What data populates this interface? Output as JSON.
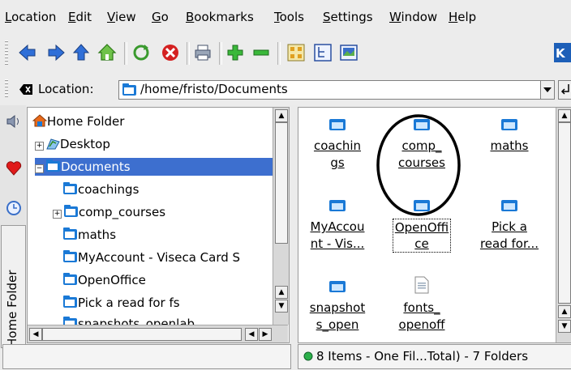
{
  "menubar": {
    "items": [
      "Location",
      "Edit",
      "View",
      "Go",
      "Bookmarks",
      "Tools",
      "Settings",
      "Window",
      "Help"
    ]
  },
  "toolbar": {
    "buttons": [
      "back-icon",
      "forward-icon",
      "up-icon",
      "home-icon",
      "reload-icon",
      "stop-icon",
      "print-icon",
      "zoom-in-icon",
      "zoom-out-icon",
      "icon-view-icon",
      "tree-view-icon",
      "image-view-icon"
    ]
  },
  "location": {
    "label": "Location:",
    "value": "/home/fristo/Documents"
  },
  "sidebar": {
    "tab_label": "Home Folder"
  },
  "tree": {
    "items": [
      {
        "label": "Home Folder",
        "icon": "home-folder-icon",
        "level": 0
      },
      {
        "label": "Desktop",
        "icon": "desktop-icon",
        "level": 1,
        "expander": "+"
      },
      {
        "label": "Documents",
        "icon": "folder-icon",
        "level": 1,
        "expander": "−",
        "selected": true
      },
      {
        "label": "coachings",
        "icon": "folder-icon",
        "level": 2
      },
      {
        "label": "comp_courses",
        "icon": "folder-icon",
        "level": 2,
        "expander": "+"
      },
      {
        "label": "maths",
        "icon": "folder-icon",
        "level": 2
      },
      {
        "label": "MyAccount - Viseca Card S",
        "icon": "folder-icon",
        "level": 2
      },
      {
        "label": "OpenOffice",
        "icon": "folder-icon",
        "level": 2
      },
      {
        "label": "Pick a read for fs",
        "icon": "folder-icon",
        "level": 2
      },
      {
        "label": "snapshots_openlab",
        "icon": "folder-icon",
        "level": 2
      }
    ]
  },
  "files": {
    "items": [
      {
        "line1": "coachin",
        "line2": "gs"
      },
      {
        "line1": "comp_",
        "line2": "courses"
      },
      {
        "line1": "maths",
        "line2": ""
      },
      {
        "line1": "MyAccou",
        "line2": "nt - Vis..."
      },
      {
        "line1": "OpenOffi",
        "line2": "ce"
      },
      {
        "line1": "Pick a",
        "line2": "read for..."
      },
      {
        "line1": "snapshot",
        "line2": "s_open"
      },
      {
        "line1": "fonts_",
        "line2": "openoff"
      }
    ]
  },
  "status": {
    "text": "8 Items - One Fil...Total) - 7 Folders"
  },
  "colors": {
    "selection": "#3d6fcf",
    "folder": "#1a79d6",
    "annotation_circle": "#000000"
  }
}
